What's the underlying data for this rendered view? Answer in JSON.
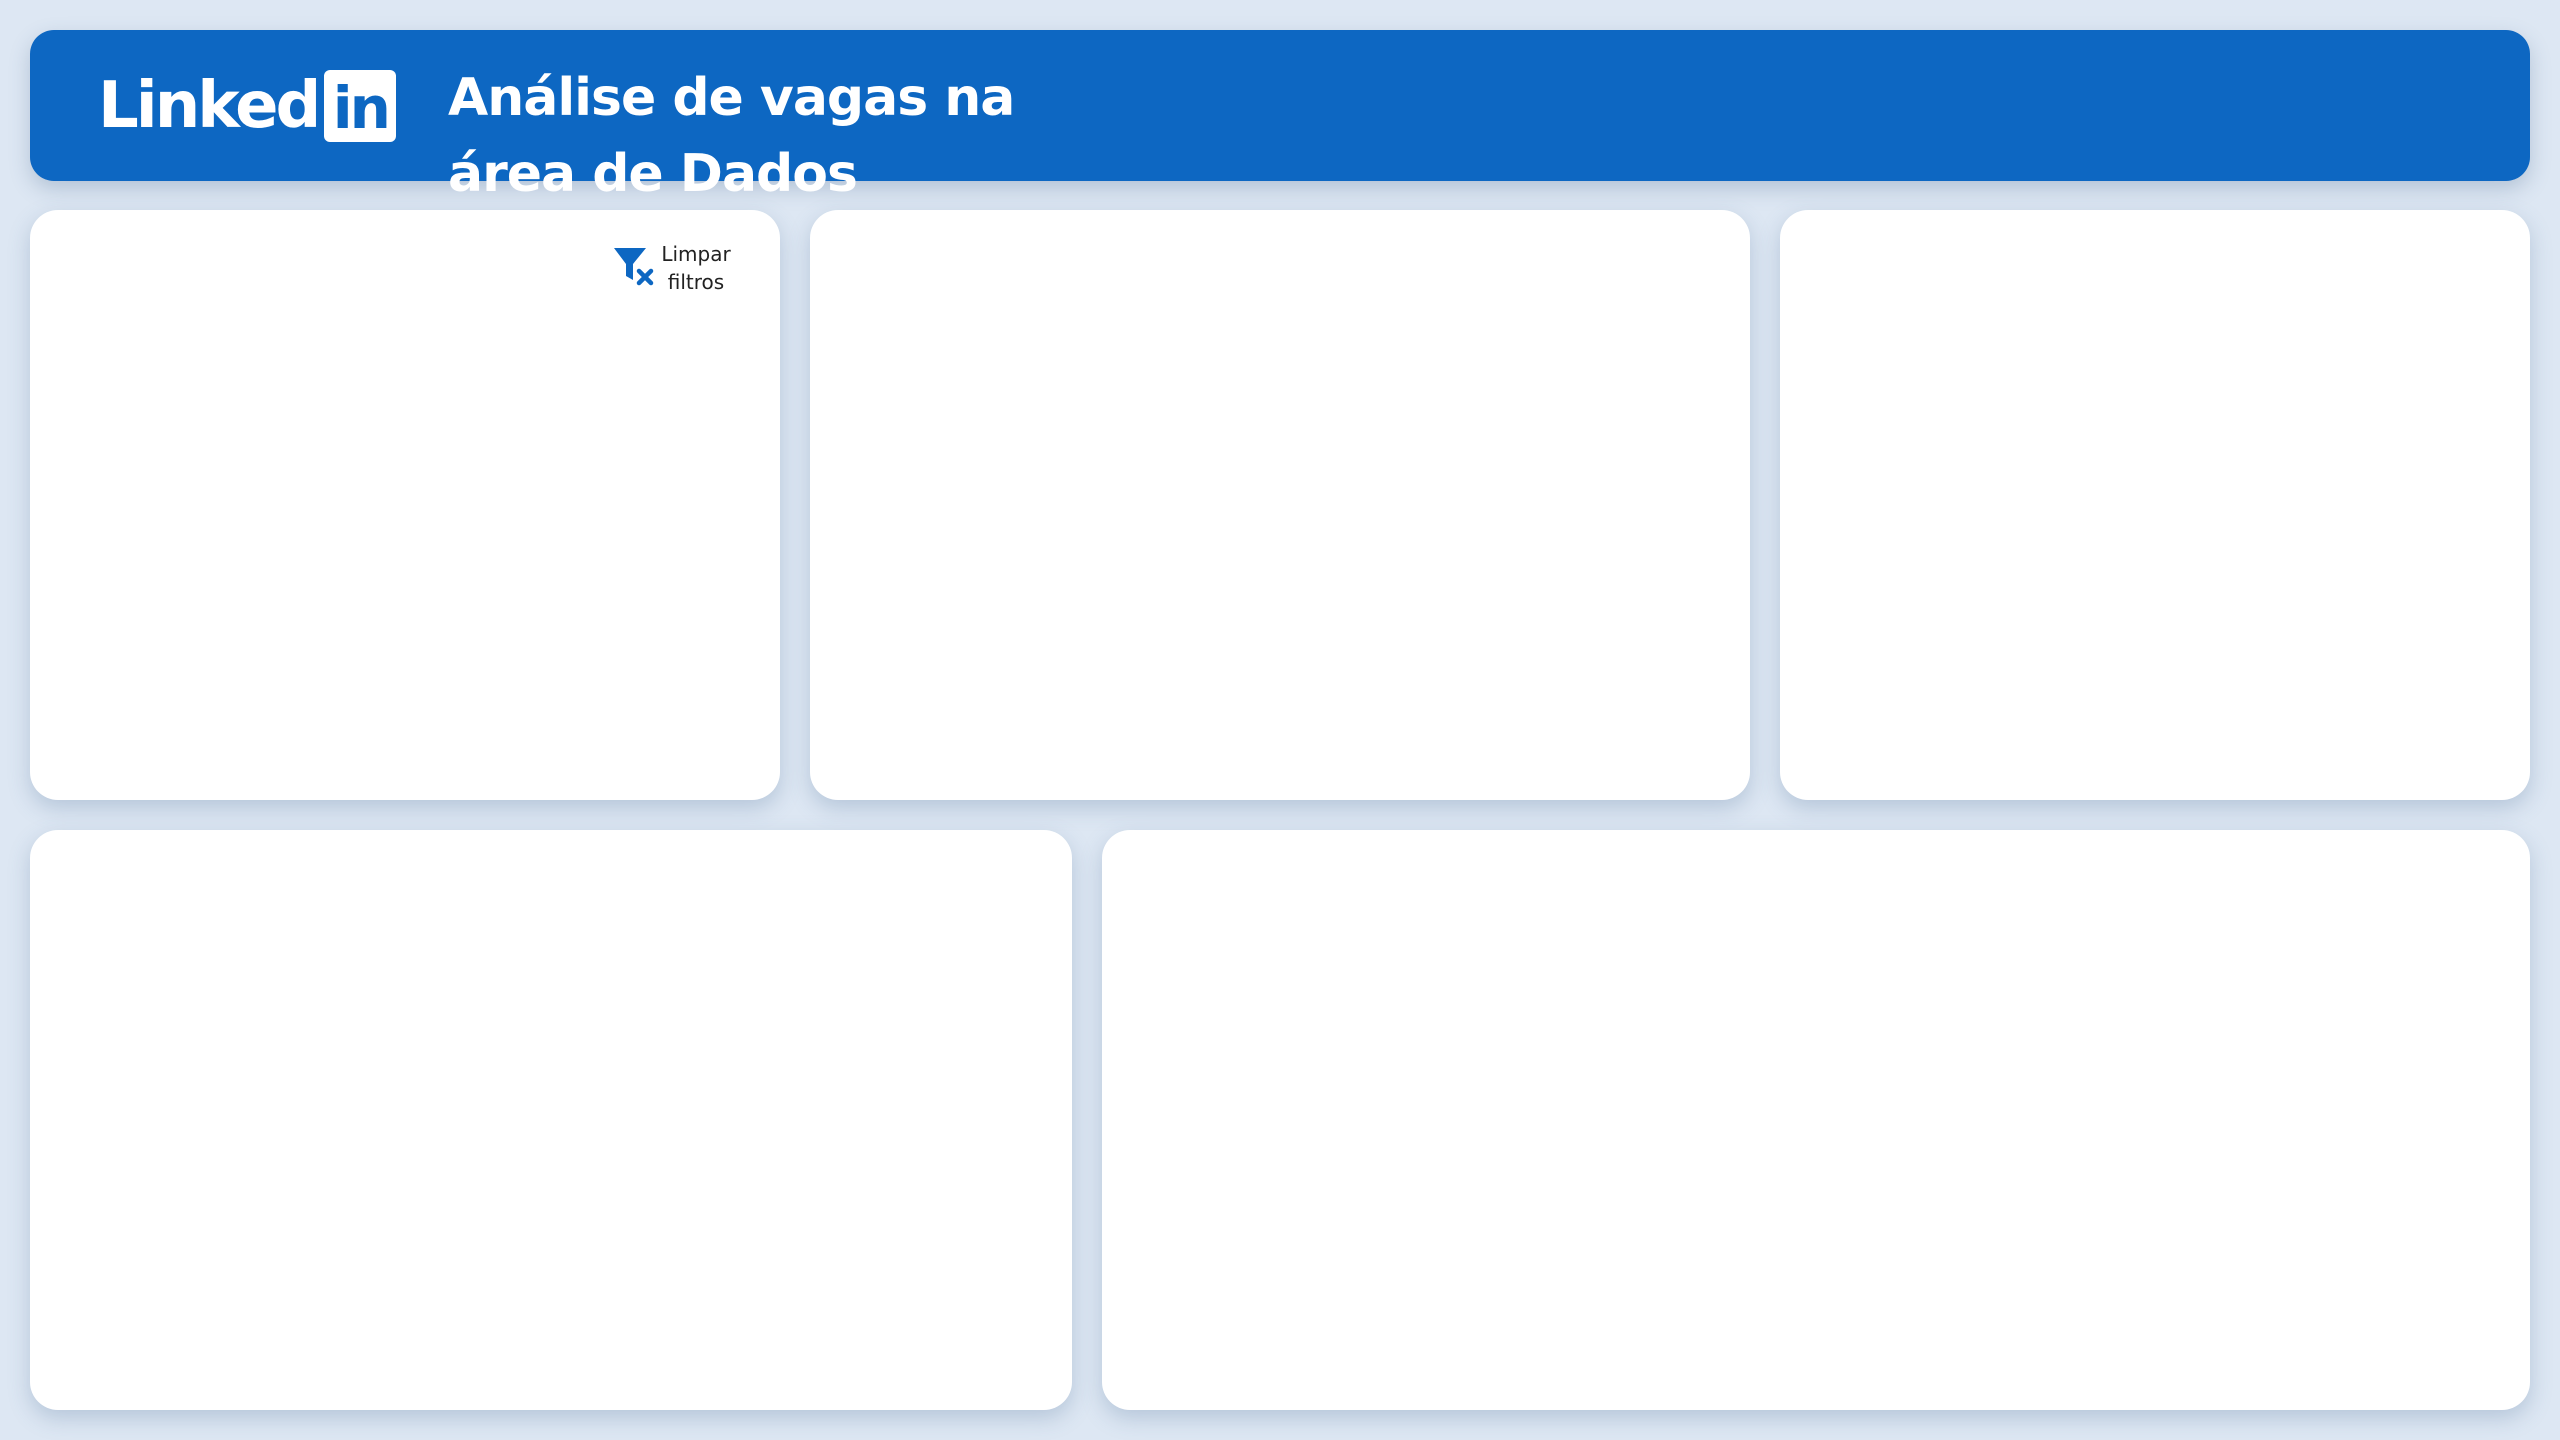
{
  "header": {
    "logo": {
      "word": "Linked",
      "box": "in",
      "icon": "linkedin-logo-icon"
    },
    "title_line1": "Análise de vagas na",
    "title_line2": "área de Dados"
  },
  "filters": {
    "clear_label": "Limpar filtros",
    "clear_icon": "filter-clear-icon"
  },
  "colors": {
    "background": "#dde7f3",
    "brand": "#0d67c2",
    "card": "#ffffff"
  }
}
